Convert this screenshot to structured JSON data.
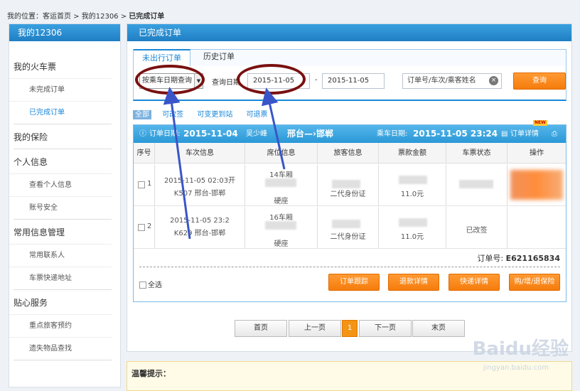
{
  "breadcrumb": {
    "path": "我的位置：客运首页 > 我的12306 > ",
    "current": "已完成订单"
  },
  "sidebar": {
    "title": "我的12306",
    "groups": [
      {
        "label": "我的火车票",
        "items": [
          "未完成订单",
          "已完成订单"
        ]
      },
      {
        "label": "我的保险",
        "items": []
      },
      {
        "label": "个人信息",
        "items": [
          "查看个人信息",
          "账号安全"
        ]
      },
      {
        "label": "常用信息管理",
        "items": [
          "常用联系人",
          "车票快递地址"
        ]
      },
      {
        "label": "贴心服务",
        "items": [
          "重点旅客预约",
          "遗失物品查找"
        ]
      }
    ]
  },
  "main": {
    "title": "已完成订单",
    "tabs": [
      "未出行订单",
      "历史订单"
    ],
    "filter": {
      "date_type": "按乘车日期查询",
      "date_label": "查询日期",
      "date_from": "2015-11-05",
      "date_sep": "-",
      "date_to": "2015-11-05",
      "keyword_placeholder": "订单号/车次/乘客姓名",
      "query_button": "查询"
    },
    "quick_filters": [
      "全部",
      "可改签",
      "可变更到站",
      "可退票"
    ],
    "order": {
      "order_date_label": "订单日期:",
      "order_date": "2015-11-04",
      "passenger": "吴少峰",
      "route": "邢台—›邯郸",
      "ride_date_label": "乘车日期:",
      "ride_date": "2015-11-05 23:24",
      "detail_link": "订单详情",
      "new_badge": "NEW",
      "columns": [
        "序号",
        "车次信息",
        "席位信息",
        "旅客信息",
        "票款金额",
        "车票状态",
        "操作"
      ],
      "rows": [
        {
          "index": "1",
          "date": "2015-11-05 02:03开",
          "train": "K507 邢台-邯郸",
          "car": "14车厢",
          "seat_type": "硬座",
          "id_type": "二代身份证",
          "price": "11.0元",
          "status": ""
        },
        {
          "index": "2",
          "date": "2015-11-05 23:2",
          "train": "K629 邢台-邯郸",
          "car": "16车厢",
          "seat_type": "硬座",
          "id_type": "二代身份证",
          "price": "11.0元",
          "status": "已改签"
        }
      ],
      "order_no_label": "订单号:",
      "order_no": "E621165834",
      "select_all": "全选",
      "actions": [
        "订单跟踪",
        "退款详情",
        "快递详情",
        "购/增/退保险"
      ]
    },
    "pager": {
      "first": "首页",
      "prev": "上一页",
      "current": "1",
      "next": "下一页",
      "last": "末页"
    }
  },
  "tips_title": "温馨提示：",
  "watermark": {
    "logo": "Baidu经验",
    "url": "jingyan.baidu.com"
  },
  "colors": {
    "header_blue": "#1f7fc4",
    "accent_orange": "#f57c0c",
    "link_blue": "#1a87d8",
    "annotation_red": "#7a1010"
  }
}
